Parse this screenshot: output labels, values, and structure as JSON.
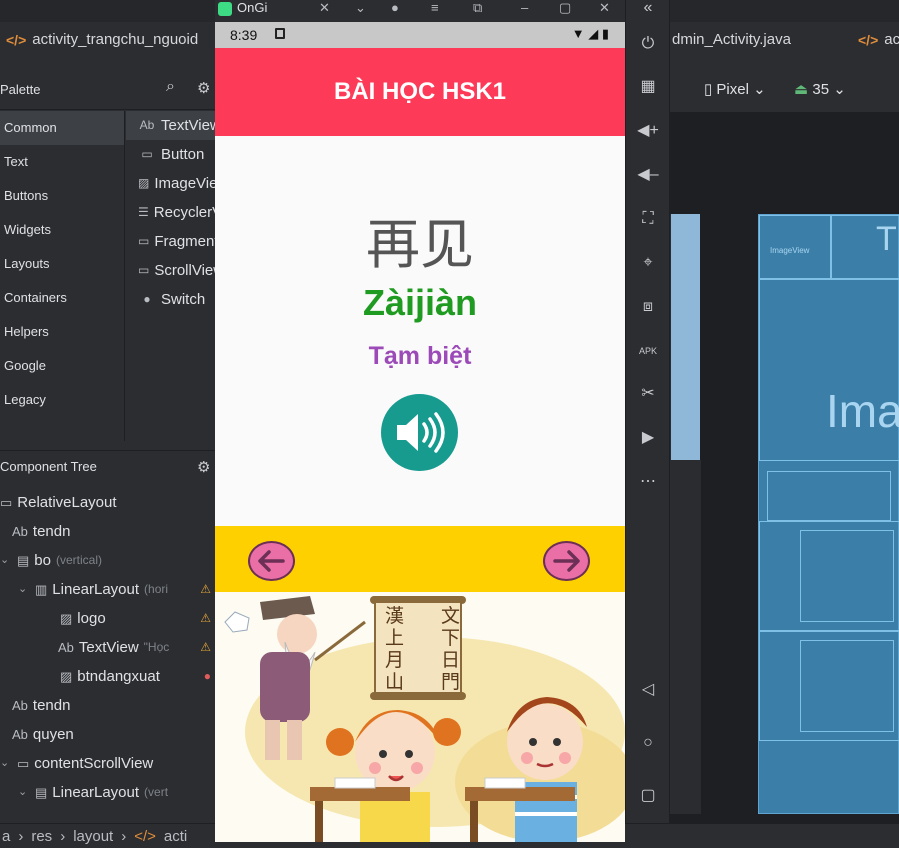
{
  "ide": {
    "tabs": [
      {
        "label": "activity_trangchu_nguoid"
      },
      {
        "label": "dmin_Activity.java"
      },
      {
        "label": "acti"
      }
    ],
    "palette": {
      "title": "Palette",
      "categories": [
        "Common",
        "Text",
        "Buttons",
        "Widgets",
        "Layouts",
        "Containers",
        "Helpers",
        "Google",
        "Legacy"
      ],
      "items": [
        "TextView",
        "Button",
        "ImageView",
        "RecyclerView",
        "FragmentContainerView",
        "ScrollView",
        "Switch"
      ],
      "item_icons": [
        "Ab",
        "▭",
        "▨",
        "☰",
        "▭",
        "▭",
        "●"
      ]
    },
    "component_tree": {
      "title": "Component Tree",
      "rows": [
        {
          "label": "RelativeLayout",
          "hint": "",
          "icon": "▭",
          "warn": ""
        },
        {
          "label": "tendn",
          "hint": "",
          "icon": "Ab",
          "warn": ""
        },
        {
          "label": "bo",
          "hint": "(vertical)",
          "icon": "▤",
          "warn": ""
        },
        {
          "label": "LinearLayout",
          "hint": "(hori",
          "icon": "▥",
          "warn": "⚠"
        },
        {
          "label": "logo",
          "hint": "",
          "icon": "▨",
          "warn": "⚠"
        },
        {
          "label": "TextView",
          "hint": "\"Học",
          "icon": "Ab",
          "warn": "⚠"
        },
        {
          "label": "btndangxuat",
          "hint": "",
          "icon": "▨",
          "warn": "●"
        },
        {
          "label": "tendn",
          "hint": "",
          "icon": "Ab",
          "warn": ""
        },
        {
          "label": "quyen",
          "hint": "",
          "icon": "Ab",
          "warn": ""
        },
        {
          "label": "contentScrollView",
          "hint": "",
          "icon": "▭",
          "warn": ""
        },
        {
          "label": "LinearLayout",
          "hint": "(vert",
          "icon": "▤",
          "warn": ""
        }
      ]
    },
    "breadcrumb": [
      "res",
      "layout",
      "acti"
    ],
    "design_toolbar": {
      "device": "Pixel",
      "api": "35"
    },
    "blueprint": {
      "image_label": "ImageView",
      "big_text": "Ima",
      "corner_text": "T"
    }
  },
  "emulator": {
    "window_title": "OnGi",
    "side_icons": [
      "power-icon",
      "rotate-icon",
      "volume-up-icon",
      "volume-down-icon",
      "screenshot-icon",
      "location-icon",
      "fold-icon",
      "apk-icon",
      "cut-icon",
      "record-icon",
      "more-icon",
      "back-icon",
      "home-icon",
      "overview-icon"
    ]
  },
  "phone": {
    "status_time": "8:39",
    "app_title": "BÀI HỌC HSK1",
    "hanzi": "再见",
    "pinyin": "Zàijiàn",
    "meaning": "Tạm biệt",
    "colors": {
      "appbar": "#fd3b58",
      "pinyin": "#1f9b21",
      "meaning": "#9b4ab8",
      "speaker": "#179b8f",
      "navbar": "#fed000",
      "arrow": "#ea6fa6"
    },
    "illustration": {
      "scroll_chars": [
        "文",
        "下",
        "漢",
        "日",
        "上",
        "門",
        "月",
        "山"
      ]
    }
  }
}
